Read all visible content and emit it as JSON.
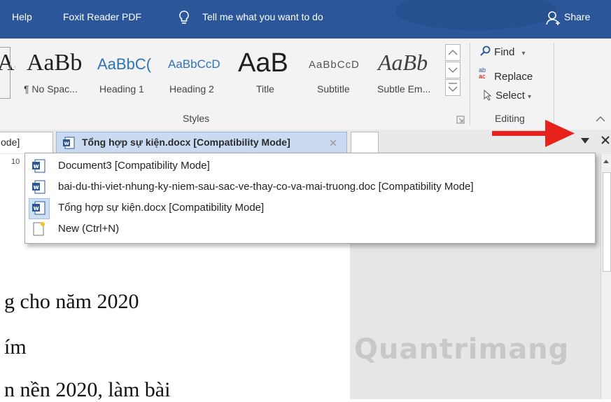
{
  "menu": {
    "help": "Help",
    "foxit": "Foxit Reader PDF",
    "tell_me": "Tell me what you want to do",
    "share": "Share"
  },
  "styles_gallery": {
    "items": [
      {
        "sample": "AaBb",
        "label": ""
      },
      {
        "sample": "AaBb",
        "label": "¶ No Spac..."
      },
      {
        "sample": "AaBbC(",
        "label": "Heading 1"
      },
      {
        "sample": "AaBbCcD",
        "label": "Heading 2"
      },
      {
        "sample": "AaB",
        "label": "Title"
      },
      {
        "sample": "AaBbCcD",
        "label": "Subtitle"
      },
      {
        "sample": "AaBb",
        "label": "Subtle Em..."
      }
    ],
    "group_label": "Styles"
  },
  "editing": {
    "find": "Find",
    "replace": "Replace",
    "select": "Select",
    "group_label": "Editing"
  },
  "tabs": {
    "partial_tab": "ode]",
    "active_tab": "Tổng hợp sự kiện.docx [Compatibility Mode]"
  },
  "ruler_number": "10",
  "dropdown": {
    "items": [
      {
        "label": "Document3 [Compatibility Mode]"
      },
      {
        "label": "bai-du-thi-viet-nhung-ky-niem-sau-sac-ve-thay-co-va-mai-truong.doc [Compatibility Mode]"
      },
      {
        "label": "Tổng hợp sự kiện.docx [Compatibility Mode]"
      },
      {
        "label": "New (Ctrl+N)"
      }
    ]
  },
  "document": {
    "line1": "g cho năm 2020",
    "line2": "ím",
    "line3": "n nền 2020, làm bài"
  },
  "watermark": "Quantrimang",
  "colors": {
    "title_bar": "#2b579a",
    "arrow": "#e8211b",
    "word_icon": "#2b579a"
  }
}
